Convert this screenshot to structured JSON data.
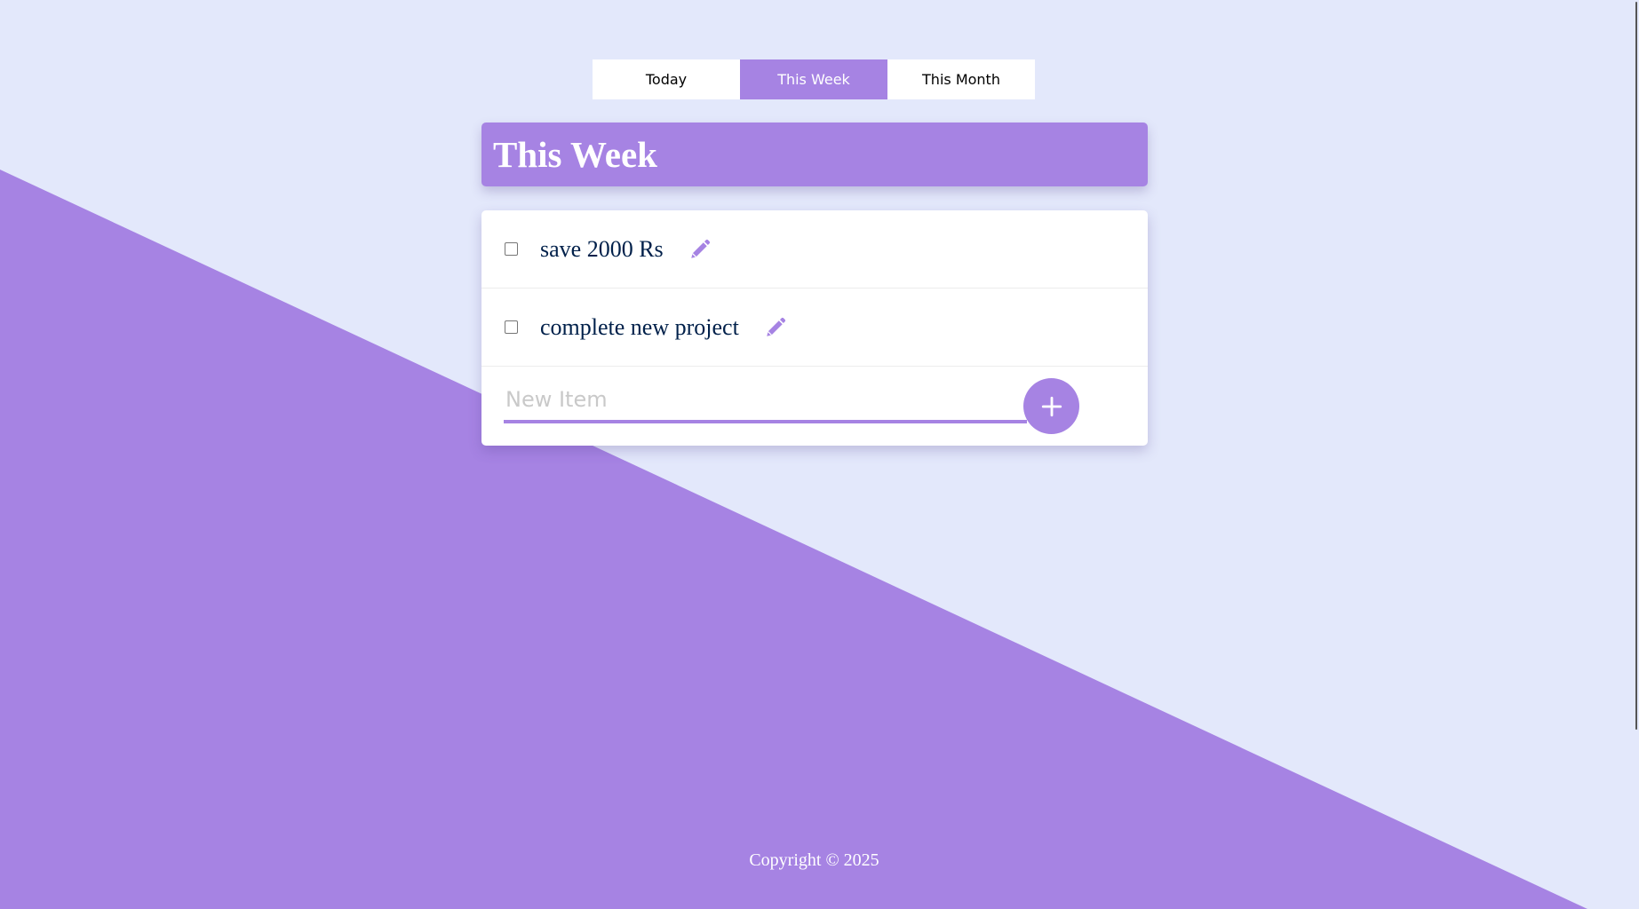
{
  "tabs": [
    {
      "label": "Today",
      "active": false
    },
    {
      "label": "This Week",
      "active": true
    },
    {
      "label": "This Month",
      "active": false
    }
  ],
  "list": {
    "title": "This Week",
    "items": [
      {
        "text": "save 2000 Rs",
        "checked": false
      },
      {
        "text": "complete new project",
        "checked": false
      }
    ],
    "new_item_placeholder": "New Item",
    "add_icon": "plus-icon",
    "edit_icon": "pencil-icon"
  },
  "footer": {
    "copyright": "Copyright © 2025"
  },
  "colors": {
    "accent": "#a683e3",
    "background": "#e3e8fb",
    "item_text": "#00204a"
  }
}
